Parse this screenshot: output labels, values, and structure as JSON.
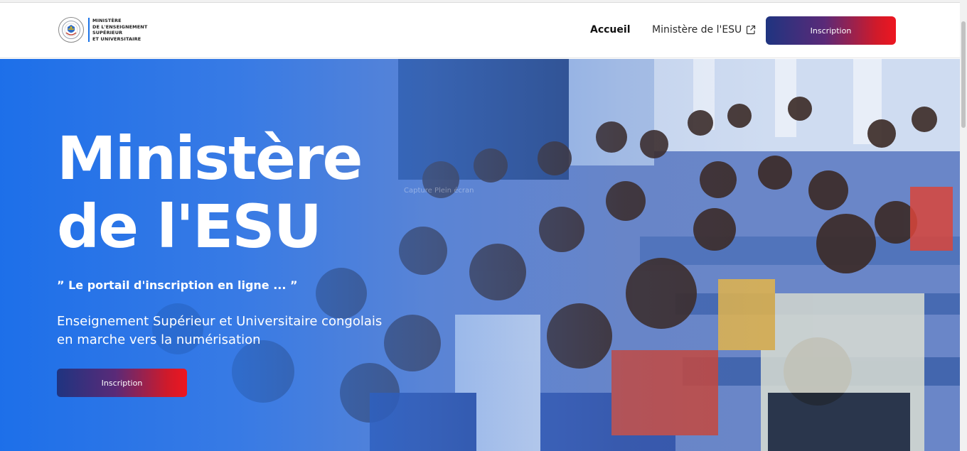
{
  "header": {
    "logo_lines": [
      "MINISTÈRE",
      "DE L'ENSEIGNEMENT",
      "SUPÉRIEUR",
      "ET UNIVERSITAIRE"
    ],
    "logo_icon": "coat-of-arms-seal-icon",
    "nav": {
      "accueil": "Accueil",
      "ministere": "Ministère de l'ESU",
      "ministere_icon": "external-link-icon"
    },
    "cta_label": "Inscription"
  },
  "hero": {
    "title_line1": "Ministère",
    "title_line2": "de l'ESU",
    "tagline": "” Le portail d'inscription en ligne ... ”",
    "description_line1": "Enseignement Supérieur et Universitaire congolais",
    "description_line2": "en marche vers la numérisation",
    "cta_label": "Inscription",
    "capture_hint": "Capture Plein écran"
  },
  "colors": {
    "accent_blue": "#1a73e8",
    "gradient_start": "#1f3480",
    "gradient_end": "#ee1620",
    "hero_overlay": "#1e6eeb"
  }
}
